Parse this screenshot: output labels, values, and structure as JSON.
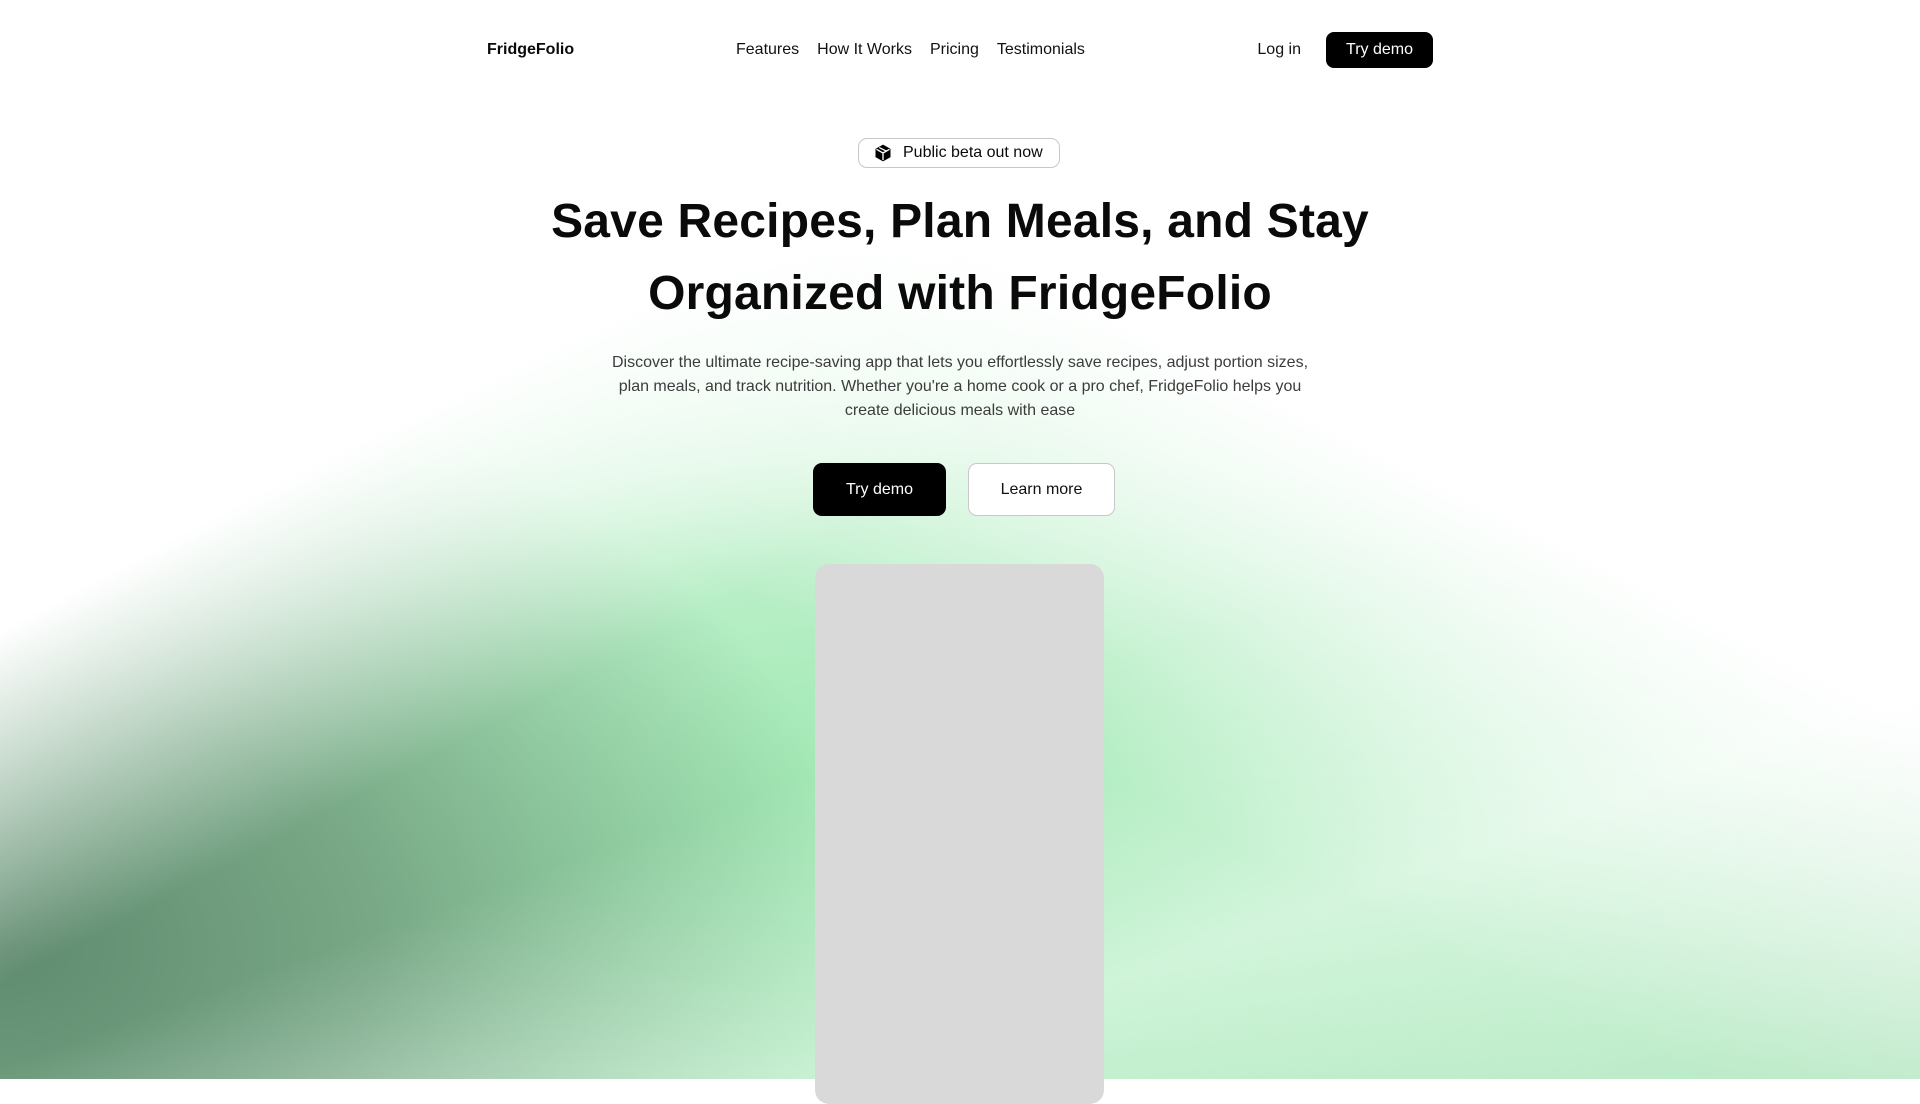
{
  "navbar": {
    "brand": "FridgeFolio",
    "links": [
      "Features",
      "How It Works",
      "Pricing",
      "Testimonials"
    ],
    "login": "Log in",
    "cta": "Try demo"
  },
  "hero": {
    "badge_icon": "cube-icon",
    "badge": "Public beta out now",
    "title": "Save Recipes, Plan Meals, and Stay Organized with FridgeFolio",
    "subtitle": "Discover the ultimate recipe-saving app that lets you effortlessly save recipes, adjust portion sizes, plan meals, and track nutrition. Whether you're a home cook or a pro chef, FridgeFolio helps you create delicious meals with ease",
    "primary_cta": "Try demo",
    "secondary_cta": "Learn more"
  },
  "colors": {
    "primary": "#000000",
    "text": "#0a0a0a",
    "muted_text": "#3c3c3c",
    "placeholder": "#d9d9d9",
    "accent_green": "#86e39e"
  }
}
